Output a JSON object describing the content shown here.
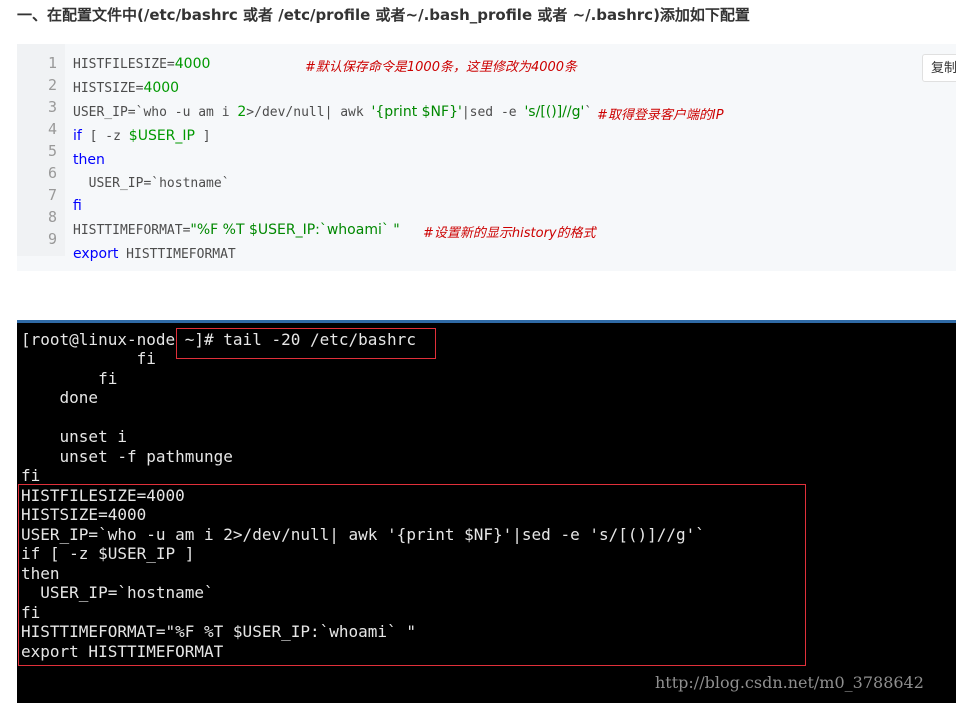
{
  "heading": "一、在配置文件中(/etc/bashrc 或者 /etc/profile 或者~/.bash_profile 或者 ~/.bashrc)添加如下配置",
  "copy_button": "复制",
  "code": {
    "line_numbers": [
      "1",
      "2",
      "3",
      "4",
      "5",
      "6",
      "7",
      "8",
      "9"
    ],
    "l1_prefix": "HISTFILESIZE=",
    "l1_num": "4000",
    "l1_comment": "#默认保存命令是1000条，这里修改为4000条",
    "l2_prefix": "HISTSIZE=",
    "l2_num": "4000",
    "l3_a": "USER_IP=`who -u am i ",
    "l3_num": "2",
    "l3_b": ">/dev/null| awk ",
    "l3_str1": "'{print $NF}'",
    "l3_c": "|sed -e ",
    "l3_str2": "'s/[()]//g'",
    "l3_d": "`",
    "l3_comment": "#取得登录客户端的IP",
    "l4_kw": "if",
    "l4_a": " [ -z ",
    "l4_var": "$USER_IP",
    "l4_b": " ]",
    "l5_kw": "then",
    "l6": "  USER_IP=`hostname`",
    "l7_kw": "fi",
    "l8_prefix": "HISTTIMEFORMAT=",
    "l8_str": "\"%F %T $USER_IP:`whoami` \"",
    "l8_comment": "#设置新的显示history的格式",
    "l9_kw": "export",
    "l9_rest": " HISTTIMEFORMAT"
  },
  "terminal": {
    "lines": [
      "[root@linux-node ~]# tail -20 /etc/bashrc",
      "            fi",
      "        fi",
      "    done",
      "",
      "    unset i",
      "    unset -f pathmunge",
      "fi",
      "HISTFILESIZE=4000",
      "HISTSIZE=4000",
      "USER_IP=`who -u am i 2>/dev/null| awk '{print $NF}'|sed -e 's/[()]//g'`",
      "if [ -z $USER_IP ]",
      "then",
      "  USER_IP=`hostname`",
      "fi",
      "HISTTIMEFORMAT=\"%F %T $USER_IP:`whoami` \"",
      "export HISTTIMEFORMAT"
    ],
    "watermark": "http://blog.csdn.net/m0_3788642"
  },
  "colors": {
    "highlight_box": "#e0303a",
    "terminal_bg": "#000000",
    "code_bg": "#f6f8fa",
    "comment": "#cc0000"
  }
}
